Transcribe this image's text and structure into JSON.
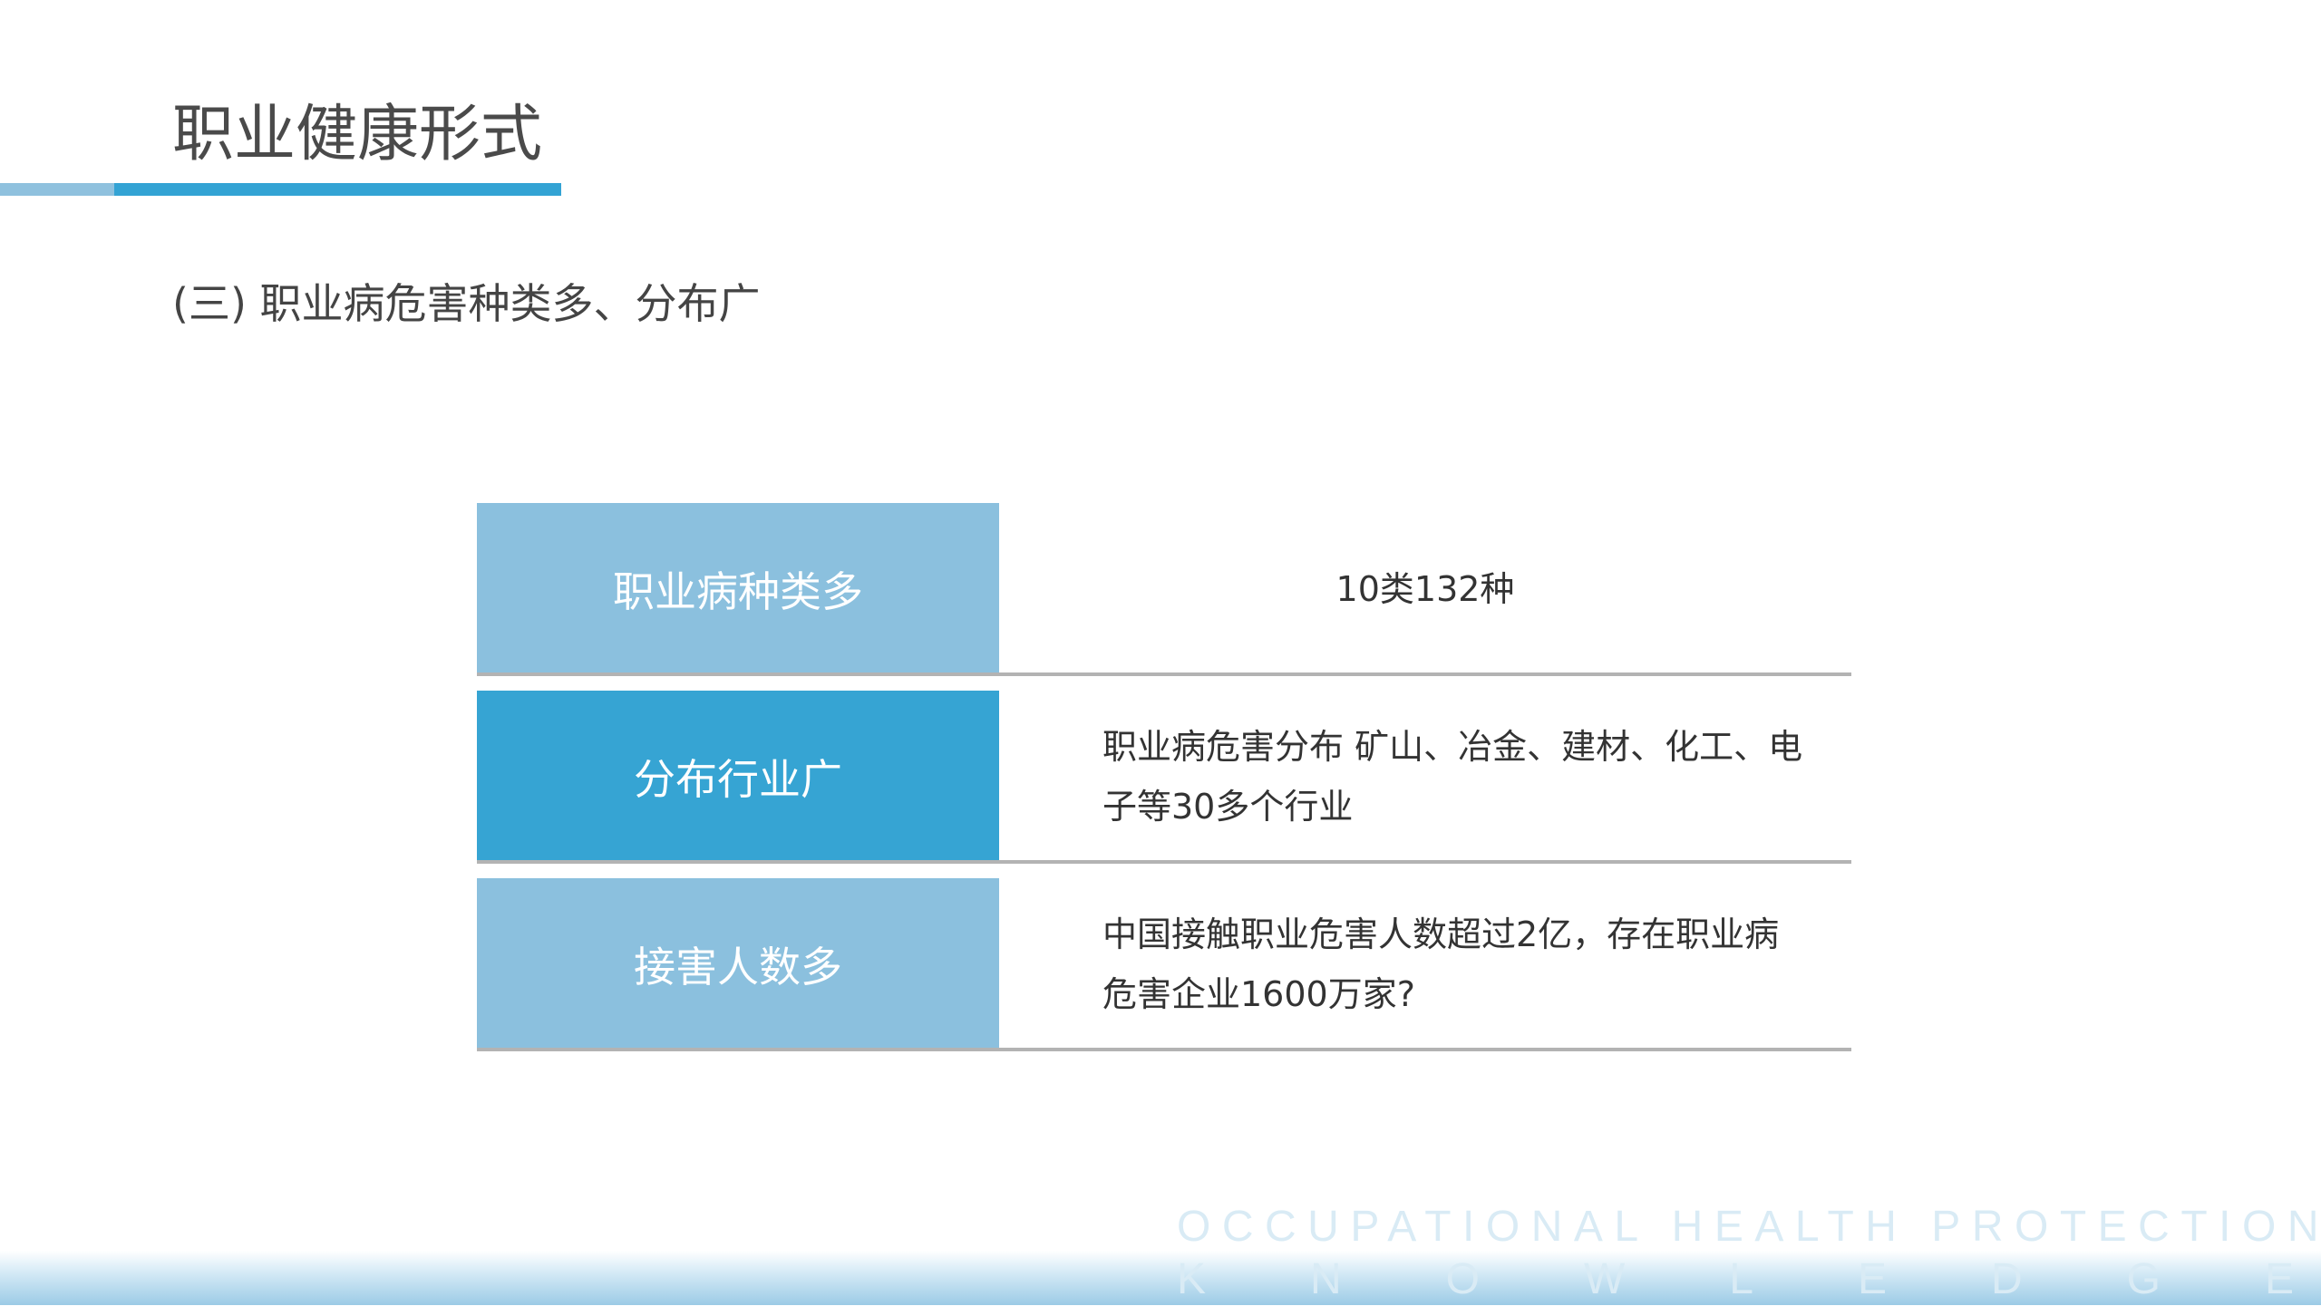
{
  "title": "职业健康形式",
  "subtitle": "(三) 职业病危害种类多、分布广",
  "rows": [
    {
      "label": "职业病种类多",
      "value": "10类132种"
    },
    {
      "label": "分布行业广",
      "value": "职业病危害分布 矿山、冶金、建材、化工、电子等30多个行业"
    },
    {
      "label": "接害人数多",
      "value": "中国接触职业危害人数超过2亿，存在职业病危害企业1600万家?"
    }
  ],
  "footer": {
    "line1": "OCCUPATIONAL HEALTH PROTECTIONG",
    "line2_letters": [
      "K",
      "N",
      "O",
      "W",
      "L",
      "E",
      "D",
      "G",
      "E"
    ]
  },
  "colors": {
    "accent": "#33a3d4",
    "accent_light": "#8bc0de",
    "text": "#4a4a4a",
    "divider": "#b3b3b3"
  }
}
